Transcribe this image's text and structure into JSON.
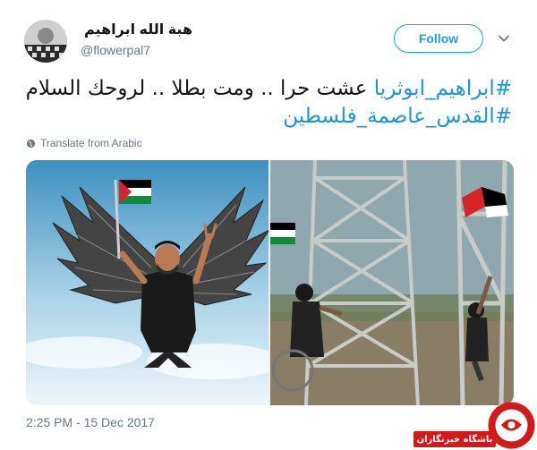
{
  "author": {
    "display_name": "هبة الله ابراهيم",
    "handle": "@flowerpal7"
  },
  "follow_label": "Follow",
  "tweet": {
    "line1_hashtag": "#ابراهيم_ابوثريا",
    "line1_text": " عشت حرا .. ومت بطلا .. لروحك السلام",
    "line2_hashtag": "#القدس_عاصمة_فلسطين"
  },
  "translate_label": "Translate from Arabic",
  "timestamp": "2:25 PM - 15 Dec 2017",
  "watermark": {
    "text": "باشگاه خبرنگاران"
  },
  "colors": {
    "accent": "#1da1f2",
    "hashtag": "#1b95e0",
    "muted": "#657786",
    "watermark_red": "#d21a1a"
  },
  "icons": {
    "menu": "chevron-down-icon",
    "translate": "globe-icon"
  }
}
